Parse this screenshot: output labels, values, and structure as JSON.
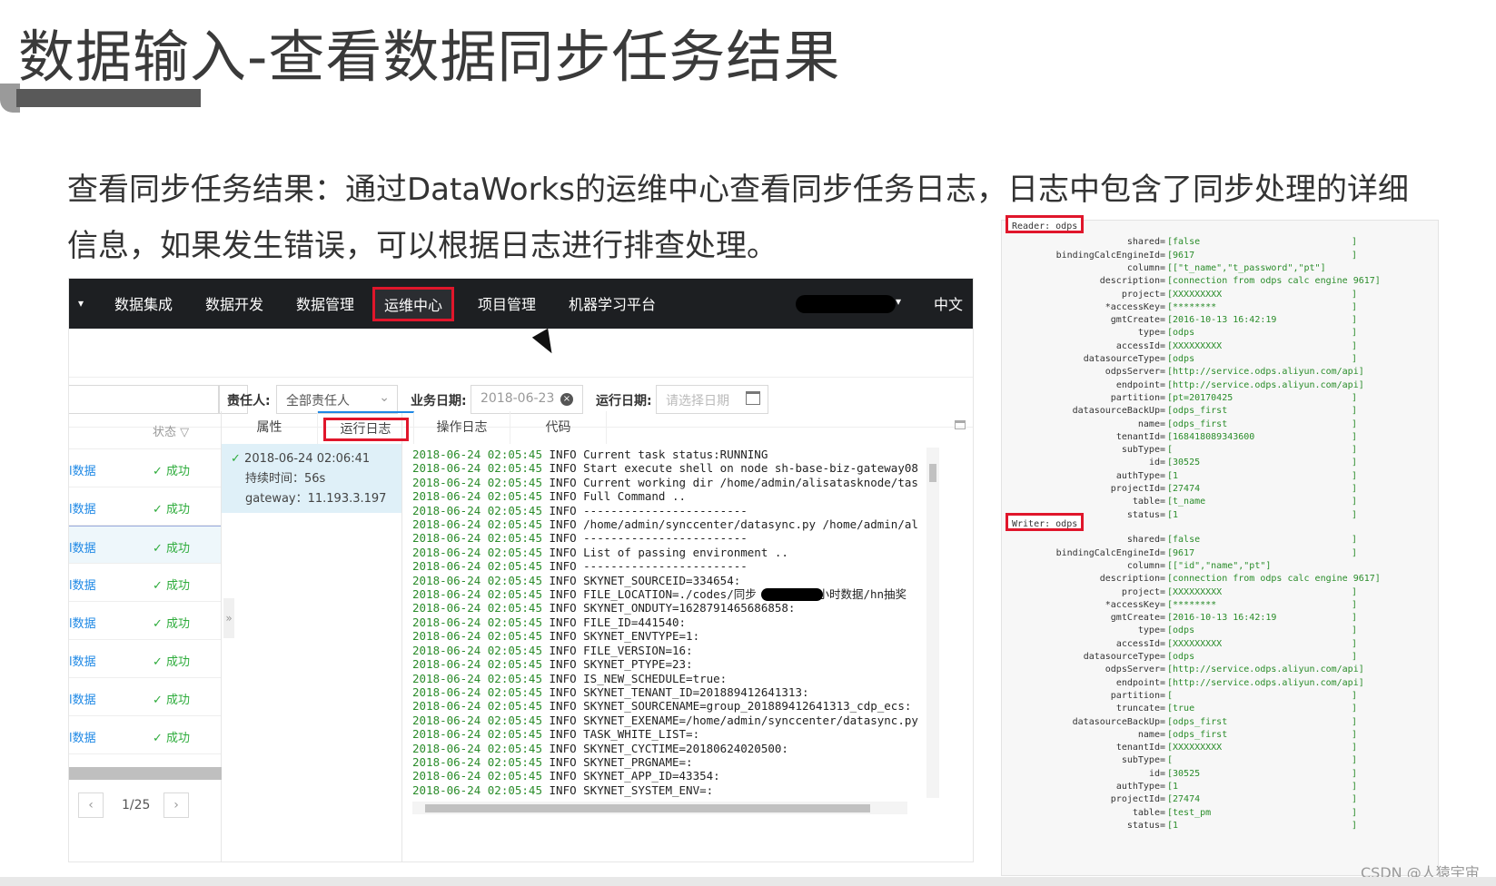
{
  "slide": {
    "title": "数据输入-查看数据同步任务结果",
    "description": "查看同步任务结果：通过DataWorks的运维中心查看同步任务日志，日志中包含了同步处理的详细信息，如果发生错误，可以根据日志进行排查处理。"
  },
  "nav": {
    "items": [
      "数据集成",
      "数据开发",
      "数据管理",
      "运维中心",
      "项目管理",
      "机器学习平台"
    ],
    "active_index": 3,
    "caret": "▾",
    "user_caret": "▾",
    "lang": "中文"
  },
  "filters": {
    "owner_label": "责任人:",
    "owner_value": "全部责任人",
    "biz_date_label": "业务日期:",
    "biz_date_value": "2018-06-23",
    "run_date_label": "运行日期:",
    "run_date_placeholder": "请选择日期"
  },
  "list": {
    "status_header": "状态",
    "rows": [
      {
        "name": "l数据",
        "status": "成功"
      },
      {
        "name": "l数据",
        "status": "成功"
      },
      {
        "name": "l数据",
        "status": "成功"
      },
      {
        "name": "l数据",
        "status": "成功"
      },
      {
        "name": "l数据",
        "status": "成功"
      },
      {
        "name": "l数据",
        "status": "成功"
      },
      {
        "name": "l数据",
        "status": "成功"
      },
      {
        "name": "l数据",
        "status": "成功"
      }
    ],
    "page": "1/25"
  },
  "instance": {
    "time": "2018-06-24 02:06:41",
    "duration": "持续时间：56s",
    "gateway": "gateway：11.193.3.197"
  },
  "tabs": [
    "属性",
    "运行日志",
    "操作日志",
    "代码"
  ],
  "active_tab": 1,
  "log_prefix": "2018-06-24 02:05:45 INFO ",
  "log_lines": [
    "Current task status:RUNNING",
    "Start execute shell on node sh-base-biz-gateway08",
    "Current working dir /home/admin/alisatasknode/tas",
    "Full Command ..",
    "------------------------",
    "/home/admin/synccenter/datasync.py /home/admin/al",
    "------------------------",
    "List of passing environment ..",
    "------------------------",
    "SKYNET_SOURCEID=334654:",
    "FILE_LOCATION=./codes/同步         小时数据/hn抽奖",
    "SKYNET_ONDUTY=1628791465686858:",
    "FILE_ID=441540:",
    "SKYNET_ENVTYPE=1:",
    "FILE_VERSION=16:",
    "SKYNET_PTYPE=23:",
    "IS_NEW_SCHEDULE=true:",
    "SKYNET_TENANT_ID=201889412641313:",
    "SKYNET_SOURCENAME=group_201889412641313_cdp_ecs:",
    "SKYNET_EXENAME=/home/admin/synccenter/datasync.py",
    "TASK_WHITE_LIST=:",
    "SKYNET_CYCTIME=20180624020500:",
    "SKYNET_PRGNAME=:",
    "SKYNET_APP_ID=43354:",
    "SKYNET_SYSTEM_ENV=:"
  ],
  "reader": {
    "header": "Reader: odps",
    "fields": [
      [
        "shared=",
        "[false"
      ],
      [
        "bindingCalcEngineId=",
        "[9617"
      ],
      [
        "column=",
        "[[\"t_name\",\"t_password\",\"pt\"]"
      ],
      [
        "description=",
        "[connection from odps calc engine 9617]"
      ],
      [
        "project=",
        "[XXXXXXXXX"
      ],
      [
        "*accessKey=",
        "[********"
      ],
      [
        "gmtCreate=",
        "[2016-10-13 16:42:19"
      ],
      [
        "type=",
        "[odps"
      ],
      [
        "accessId=",
        "[XXXXXXXXX"
      ],
      [
        "datasourceType=",
        "[odps"
      ],
      [
        "odpsServer=",
        "[http://service.odps.aliyun.com/api]"
      ],
      [
        "endpoint=",
        "[http://service.odps.aliyun.com/api]"
      ],
      [
        "partition=",
        "[pt=20170425"
      ],
      [
        "datasourceBackUp=",
        "[odps_first"
      ],
      [
        "name=",
        "[odps_first"
      ],
      [
        "tenantId=",
        "[168418089343600"
      ],
      [
        "subType=",
        "["
      ],
      [
        "id=",
        "[30525"
      ],
      [
        "authType=",
        "[1"
      ],
      [
        "projectId=",
        "[27474"
      ],
      [
        "table=",
        "[t_name"
      ],
      [
        "status=",
        "[1"
      ]
    ]
  },
  "writer": {
    "header": "Writer: odps",
    "fields": [
      [
        "shared=",
        "[false"
      ],
      [
        "bindingCalcEngineId=",
        "[9617"
      ],
      [
        "column=",
        "[[\"id\",\"name\",\"pt\"]"
      ],
      [
        "description=",
        "[connection from odps calc engine 9617]"
      ],
      [
        "project=",
        "[XXXXXXXXX"
      ],
      [
        "*accessKey=",
        "[********"
      ],
      [
        "gmtCreate=",
        "[2016-10-13 16:42:19"
      ],
      [
        "type=",
        "[odps"
      ],
      [
        "accessId=",
        "[XXXXXXXXX"
      ],
      [
        "datasourceType=",
        "[odps"
      ],
      [
        "odpsServer=",
        "[http://service.odps.aliyun.com/api]"
      ],
      [
        "endpoint=",
        "[http://service.odps.aliyun.com/api]"
      ],
      [
        "partition=",
        "["
      ],
      [
        "truncate=",
        "[true"
      ],
      [
        "datasourceBackUp=",
        "[odps_first"
      ],
      [
        "name=",
        "[odps_first"
      ],
      [
        "tenantId=",
        "[XXXXXXXXX"
      ],
      [
        "subType=",
        "["
      ],
      [
        "id=",
        "[30525"
      ],
      [
        "authType=",
        "[1"
      ],
      [
        "projectId=",
        "[27474"
      ],
      [
        "table=",
        "[test_pm"
      ],
      [
        "status=",
        "[1"
      ]
    ]
  },
  "watermark": "CSDN @人猿宇宙",
  "colors": {
    "highlight": "#e0162b",
    "success": "#2eac3c",
    "nav_bg": "#1d1f22",
    "log_green": "#2a8c2a"
  }
}
